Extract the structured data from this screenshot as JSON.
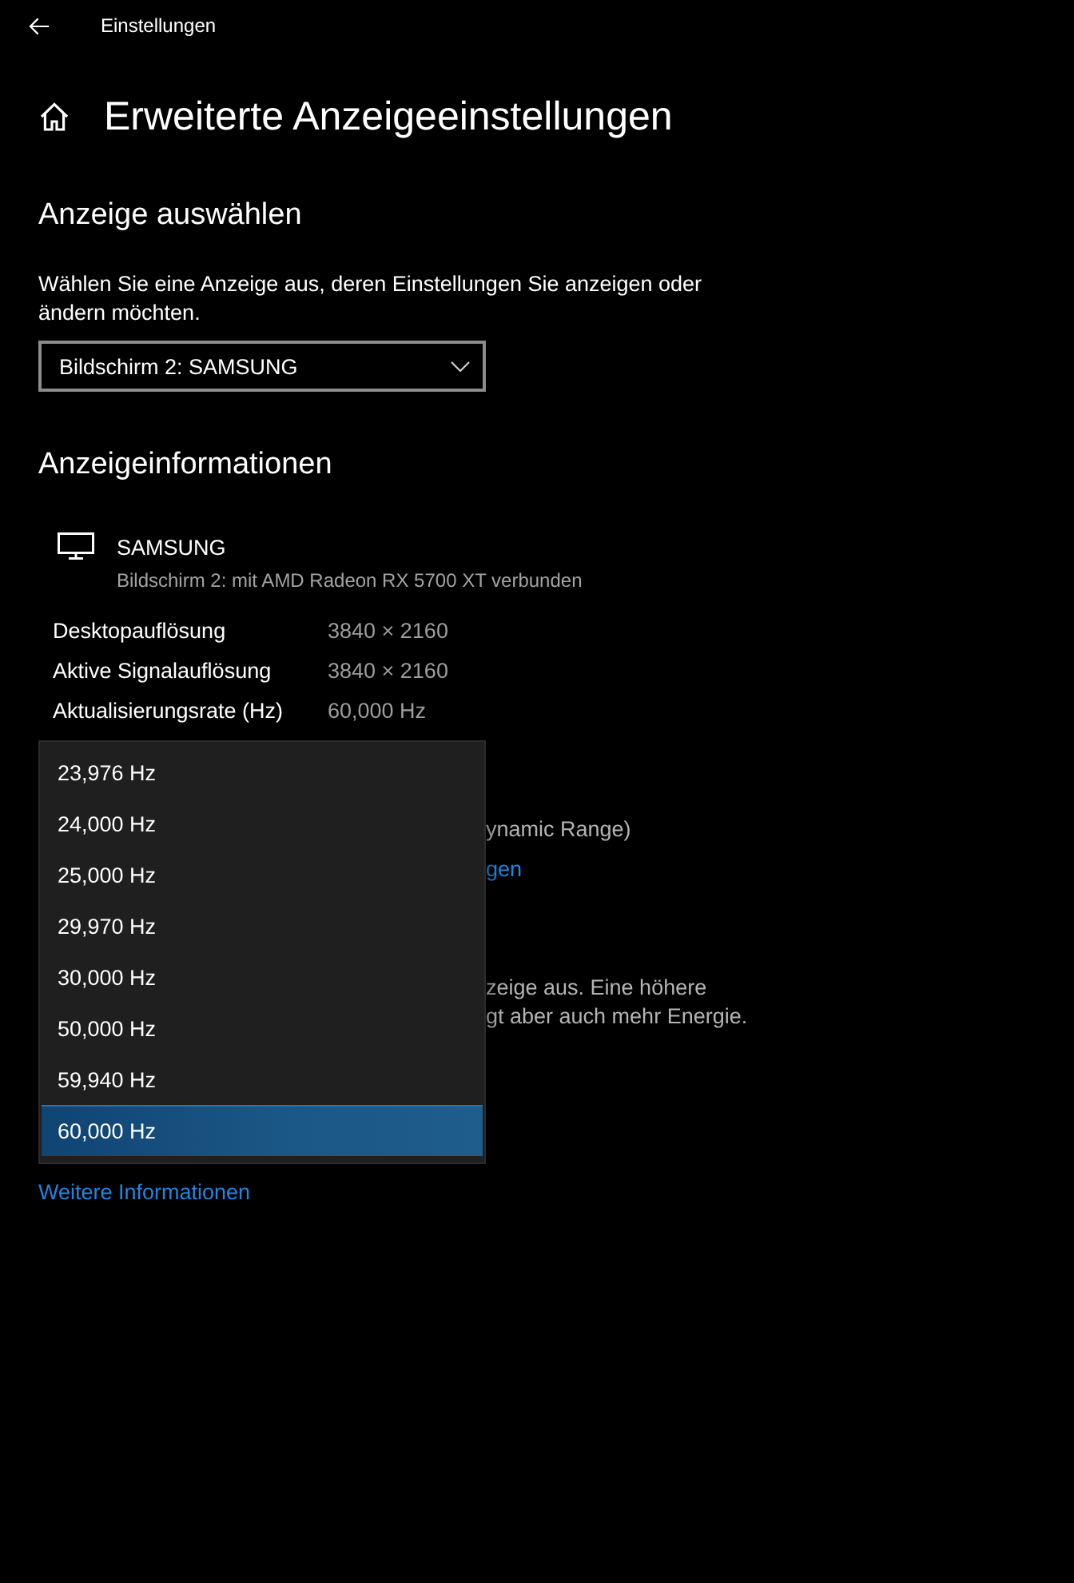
{
  "header": {
    "title": "Einstellungen"
  },
  "page_title": "Erweiterte Anzeigeeinstellungen",
  "select_display": {
    "heading": "Anzeige auswählen",
    "description": "Wählen Sie eine Anzeige aus, deren Einstellungen Sie anzeigen oder ändern möchten.",
    "dropdown": {
      "value": "Bildschirm 2: SAMSUNG"
    }
  },
  "display_info": {
    "heading": "Anzeigeinformationen",
    "monitor": {
      "name": "SAMSUNG",
      "subtitle": "Bildschirm 2: mit AMD Radeon RX 5700 XT verbunden"
    },
    "rows": [
      {
        "label": "Desktopauflösung",
        "value": "3840 × 2160"
      },
      {
        "label": "Aktive Signalauflösung",
        "value": "3840 × 2160"
      },
      {
        "label": "Aktualisierungsrate (Hz)",
        "value": "60,000 Hz"
      }
    ]
  },
  "partially_hidden_sections": [
    {
      "lines": [
        {
          "kind": "text",
          "text": "ynamic Range)"
        },
        {
          "kind": "link",
          "text": "gen"
        }
      ]
    },
    {
      "lines": [
        {
          "kind": "text",
          "text": "zeige aus. Eine höhere"
        },
        {
          "kind": "text",
          "text": "gt aber auch mehr Energie."
        }
      ]
    }
  ],
  "more_info_link": "Weitere Informationen",
  "refresh_rate_menu": {
    "options": [
      {
        "label": "23,976 Hz",
        "selected": false
      },
      {
        "label": "24,000 Hz",
        "selected": false
      },
      {
        "label": "25,000 Hz",
        "selected": false
      },
      {
        "label": "29,970 Hz",
        "selected": false
      },
      {
        "label": "30,000 Hz",
        "selected": false
      },
      {
        "label": "50,000 Hz",
        "selected": false
      },
      {
        "label": "59,940 Hz",
        "selected": false
      },
      {
        "label": "60,000 Hz",
        "selected": true
      }
    ]
  }
}
